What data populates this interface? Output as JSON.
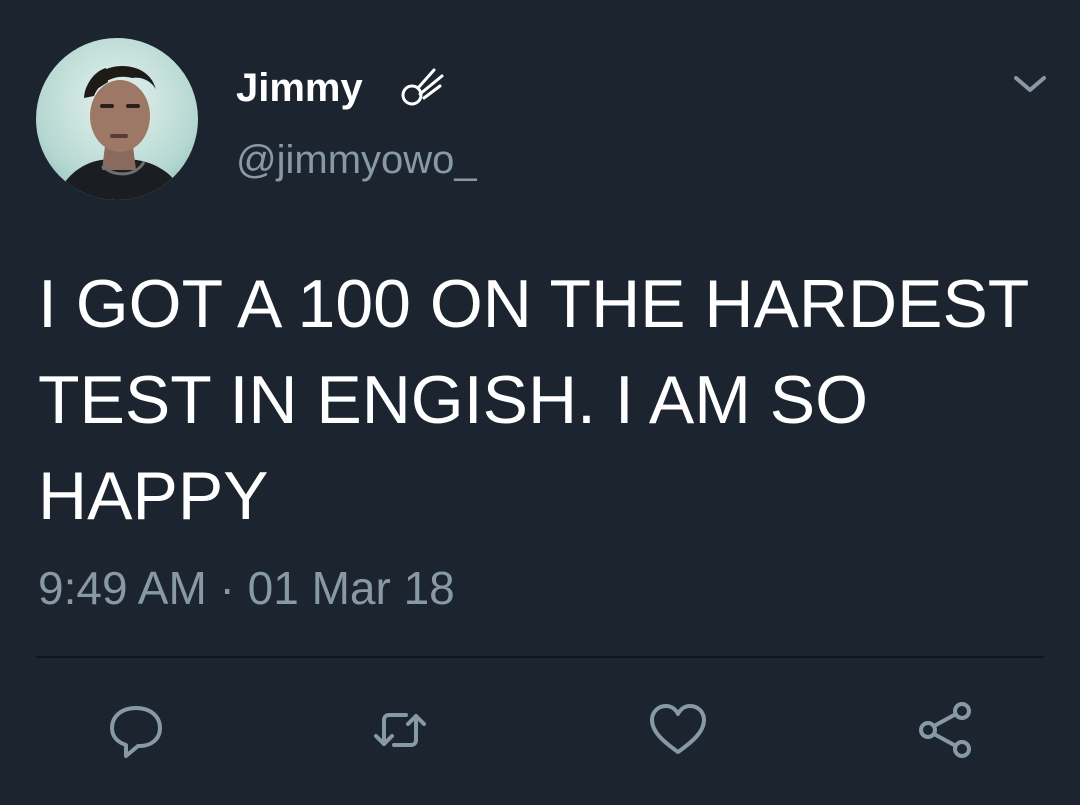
{
  "tweet": {
    "author": {
      "name": "Jimmy",
      "handle": "@jimmyowo_",
      "name_icon": "comet-icon",
      "avatar": "avatar-photo"
    },
    "text": "I GOT A 100 ON THE HARDEST TEST IN ENGISH. I AM SO HAPPY",
    "timestamp": "9:49 AM · 01 Mar 18",
    "menu_icon": "chevron-down-icon"
  },
  "actions": [
    {
      "icon": "reply-icon"
    },
    {
      "icon": "retweet-icon"
    },
    {
      "icon": "heart-icon"
    },
    {
      "icon": "share-icon"
    }
  ],
  "colors": {
    "background": "#1c2430",
    "text_primary": "#ffffff",
    "text_secondary": "#8899a6",
    "icon": "#8899a6",
    "divider": "#0f151c"
  }
}
